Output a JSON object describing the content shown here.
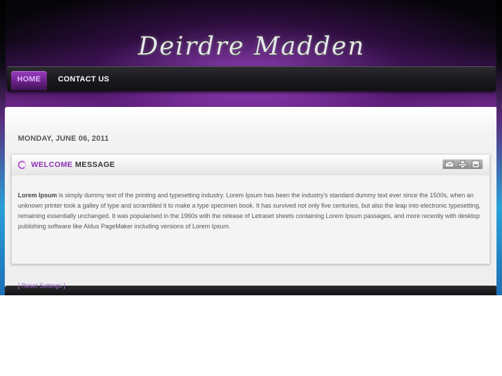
{
  "header": {
    "site_title": "Deirdre Madden"
  },
  "nav": {
    "items": [
      {
        "label": "HOME",
        "active": true
      },
      {
        "label": "CONTACT US",
        "active": false
      }
    ]
  },
  "content": {
    "date": "MONDAY, JUNE 06, 2011",
    "article": {
      "title_accent": "WELCOME",
      "title_rest": "MESSAGE",
      "body_lead": "Lorem Ipsum",
      "body_text": " is simply dummy text of the printing and typesetting industry. Lorem Ipsum has been the industry's standard dummy text ever since the 1500s, when an unknown printer took a galley of type and scrambled it to make a type specimen book. It has survived not only five centuries, but also the leap into electronic typesetting, remaining essentially unchanged. It was popularised in the 1960s with the release of Letraset sheets containing Lorem Ipsum passages, and more recently with desktop publishing software like Aldus PageMaker including versions of Lorem Ipsum.",
      "action_icons": [
        "email-icon",
        "print-icon",
        "pdf-icon"
      ]
    }
  },
  "footer": {
    "reset_label": "[ Reset Settings ]"
  },
  "colors": {
    "accent": "#8e2fb3",
    "nav_active": "#6a2189"
  }
}
